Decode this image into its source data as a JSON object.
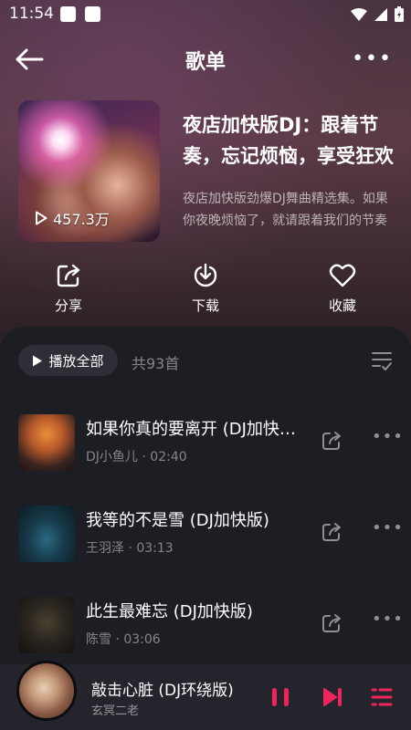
{
  "status_bar": {
    "time": "11:54"
  },
  "header": {
    "title": "歌单"
  },
  "playlist": {
    "title": "夜店加快版DJ：跟着节奏，忘记烦恼，享受狂欢",
    "description": "夜店加快版劲爆DJ舞曲精选集。如果你夜晚烦恼了，就请跟着我们的节奏一起摇摆吧",
    "play_count": "457.3万"
  },
  "actions": {
    "share": "分享",
    "download": "下载",
    "favorite": "收藏"
  },
  "list": {
    "play_all": "播放全部",
    "count": "共93首",
    "songs": [
      {
        "title": "如果你真的要离开 (DJ加快版)",
        "artist": "DJ小鱼儿",
        "duration": "02:40"
      },
      {
        "title": "我等的不是雪 (DJ加快版)",
        "artist": "王羽泽",
        "duration": "03:13"
      },
      {
        "title": "此生最难忘 (DJ加快版)",
        "artist": "陈雪",
        "duration": "03:06"
      }
    ]
  },
  "now_playing": {
    "title": "敲击心脏 (DJ环绕版)",
    "artist": "玄冥二老"
  },
  "colors": {
    "accent": "#f0245c",
    "panel": "#1d1e24"
  },
  "icons": [
    "back-icon",
    "more-icon",
    "play-icon",
    "share-icon",
    "download-icon",
    "heart-icon",
    "multi-select-icon",
    "pause-icon",
    "next-icon",
    "playlist-icon"
  ]
}
